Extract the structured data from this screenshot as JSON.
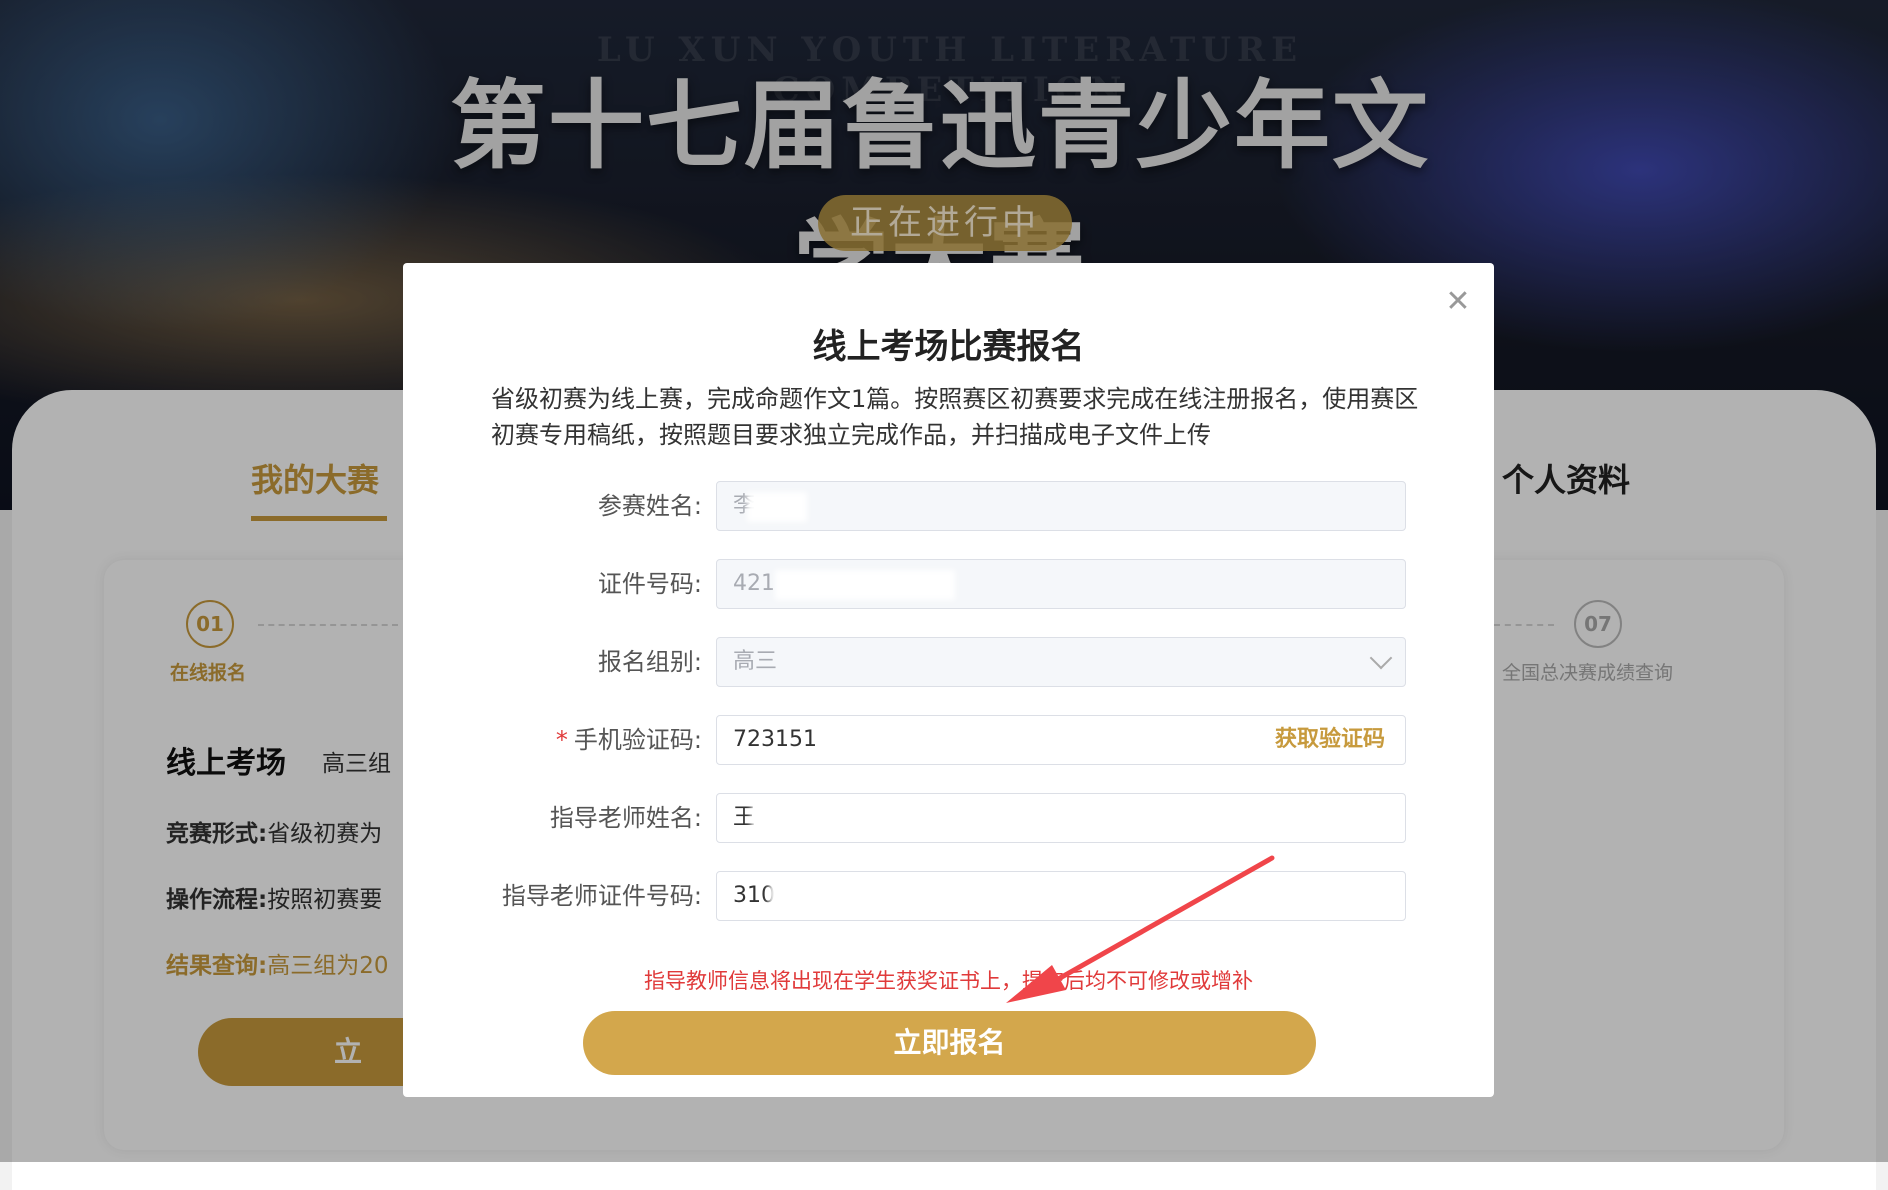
{
  "hero": {
    "en_title": "LU XUN YOUTH LITERATURE COMPETITION",
    "title": "第十七届鲁迅青少年文学大赛",
    "status": "正在进行中"
  },
  "tabs": [
    {
      "label": "我的大赛"
    },
    {
      "label": "个人资料"
    }
  ],
  "steps": [
    {
      "num": "01",
      "label": "在线报名"
    },
    {
      "num": "07",
      "label": "全国总决赛成绩查询"
    }
  ],
  "background_content": {
    "heading": "线上考场",
    "group": "高三组",
    "rows": [
      {
        "label": "竞赛形式:",
        "value": "省级初赛为"
      },
      {
        "label": "操作流程:",
        "value": "按照初赛要"
      },
      {
        "label": "结果查询:",
        "value": "高三组为20"
      }
    ],
    "button": "立"
  },
  "modal": {
    "title": "线上考场比赛报名",
    "description": "省级初赛为线上赛，完成命题作文1篇。按照赛区初赛要求完成在线注册报名，使用赛区初赛专用稿纸，按照题目要求独立完成作品，并扫描成电子文件上传",
    "fields": {
      "name": {
        "label": "参赛姓名:",
        "value": "李"
      },
      "id": {
        "label": "证件号码:",
        "value": "421"
      },
      "group": {
        "label": "报名组别:",
        "value": "高三"
      },
      "phone_code": {
        "label": "手机验证码:",
        "required_mark": "*",
        "value": "723151",
        "action": "获取验证码"
      },
      "teacher_name": {
        "label": "指导老师姓名:",
        "value": "王"
      },
      "teacher_id": {
        "label": "指导老师证件号码:",
        "value": "310"
      }
    },
    "warning": "指导教师信息将出现在学生获奖证书上，提交后均不可修改或增补",
    "submit": "立即报名",
    "close_icon": "close-icon"
  },
  "colors": {
    "accent": "#c79a3d",
    "button": "#d3a74c",
    "warning": "#e03a3a",
    "annotation_arrow": "#f0454a"
  }
}
